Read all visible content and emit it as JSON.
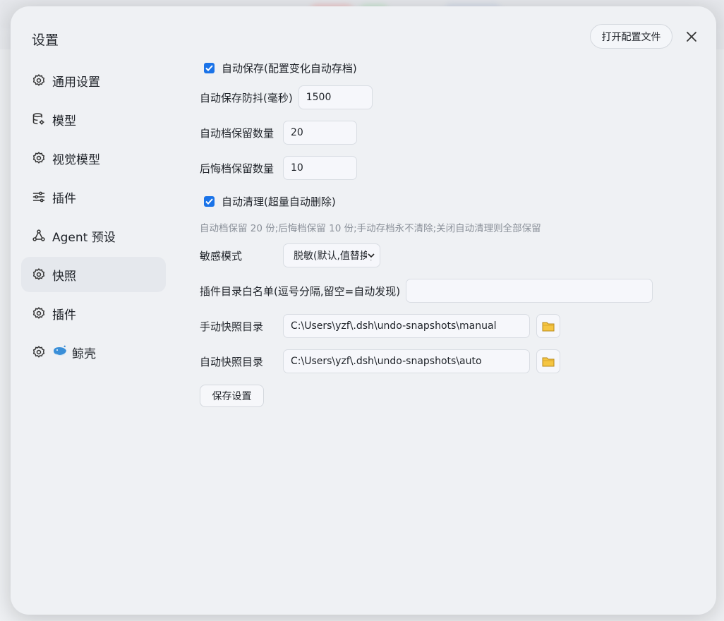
{
  "dialog": {
    "title": "设置",
    "open_config_label": "打开配置文件"
  },
  "sidebar": {
    "items": [
      {
        "label": "通用设置",
        "icon": "gear-icon"
      },
      {
        "label": "模型",
        "icon": "database-gear-icon"
      },
      {
        "label": "视觉模型",
        "icon": "gear-icon"
      },
      {
        "label": "插件",
        "icon": "sliders-icon"
      },
      {
        "label": "Agent 预设",
        "icon": "agent-network-icon"
      },
      {
        "label": "快照",
        "icon": "gear-icon",
        "active": true
      },
      {
        "label": "插件",
        "icon": "gear-icon"
      },
      {
        "label": "鲸壳",
        "icon": "gear-icon",
        "emoji": "🐳"
      }
    ]
  },
  "settings": {
    "autosave_label": "自动保存(配置变化自动存档)",
    "autosave_checked": true,
    "debounce_label": "自动保存防抖(毫秒)",
    "debounce_value": "1500",
    "auto_keep_label": "自动档保留数量",
    "auto_keep_value": "20",
    "undo_keep_label": "后悔档保留数量",
    "undo_keep_value": "10",
    "autoclean_label": "自动清理(超量自动删除)",
    "autoclean_checked": true,
    "hint": "自动档保留 20 份;后悔档保留 10 份;手动存档永不清除;关闭自动清理则全部保留",
    "sensitive_label": "敏感模式",
    "sensitive_value": "脱敏(默认,值替换)",
    "whitelist_label": "插件目录白名单(逗号分隔,留空=自动发现)",
    "whitelist_value": "",
    "manual_dir_label": "手动快照目录",
    "manual_dir_value": "C:\\Users\\yzf\\.dsh\\undo-snapshots\\manual",
    "auto_dir_label": "自动快照目录",
    "auto_dir_value": "C:\\Users\\yzf\\.dsh\\undo-snapshots\\auto",
    "save_label": "保存设置"
  },
  "colors": {
    "accent": "#1a73e8",
    "folder": "#f5c542"
  }
}
